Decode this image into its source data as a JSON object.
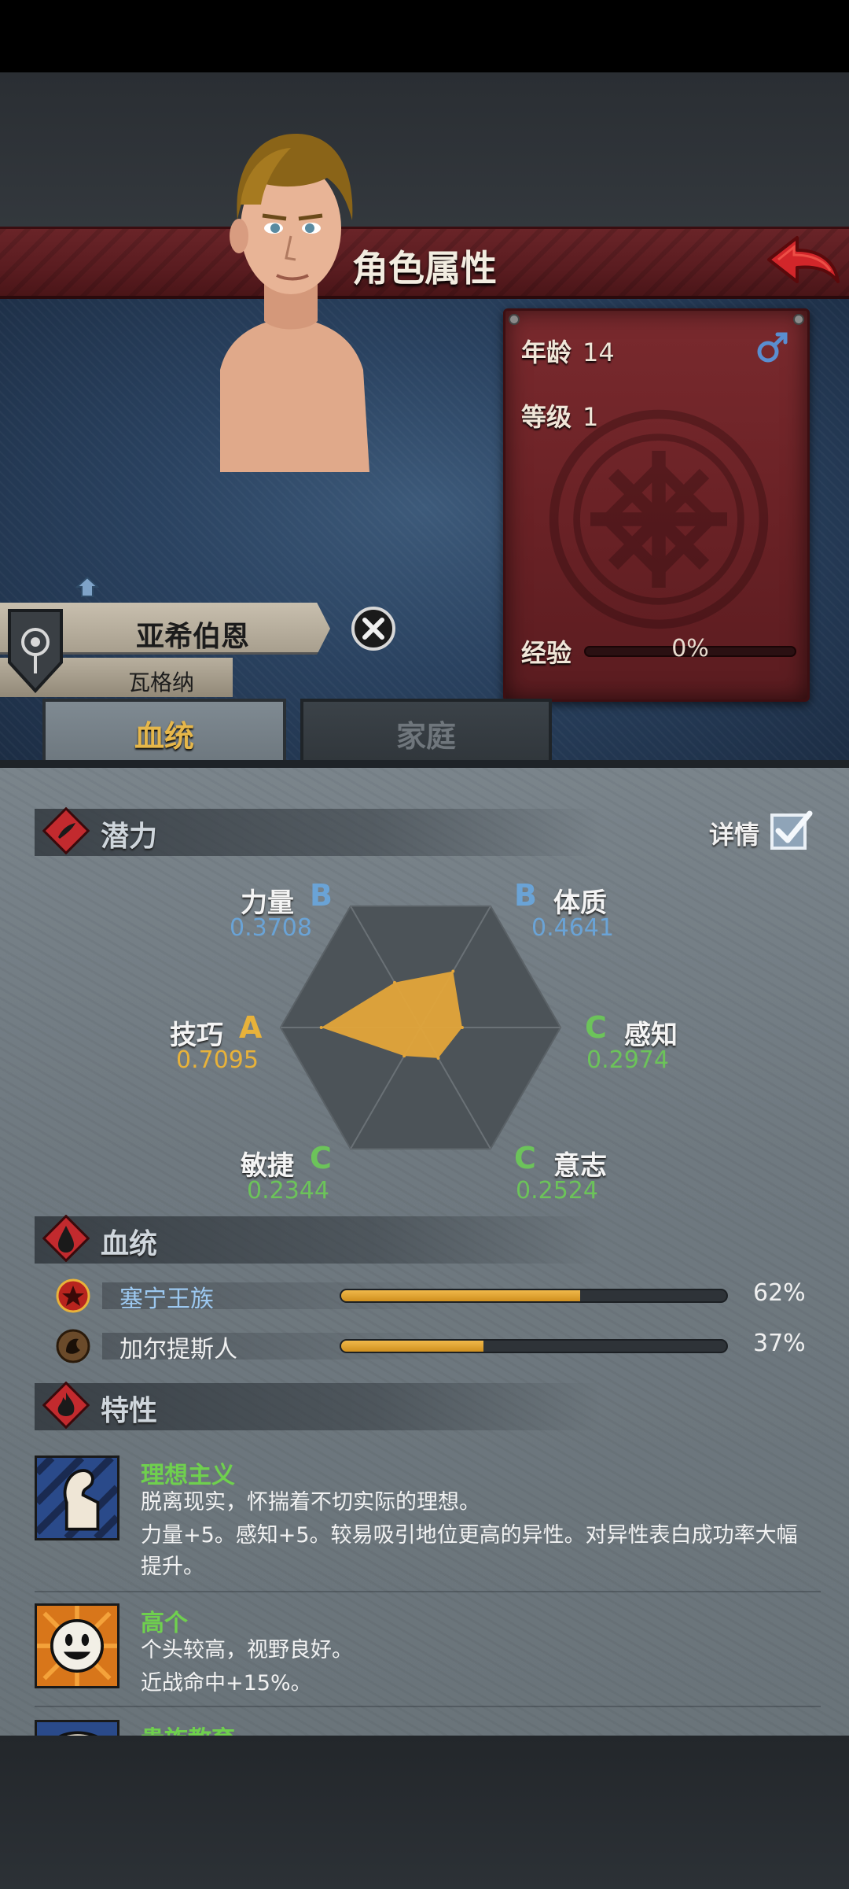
{
  "header": {
    "title": "角色属性"
  },
  "character": {
    "age_label": "年龄",
    "age_value": "14",
    "level_label": "等级",
    "level_value": "1",
    "xp_label": "经验",
    "xp_value": "0%",
    "xp_fraction": 0.0,
    "name": "亚希伯恩",
    "family_name": "瓦格纳",
    "gender": "male"
  },
  "tabs": [
    {
      "label": "血统",
      "active": true
    },
    {
      "label": "家庭",
      "active": false
    }
  ],
  "potential": {
    "title": "潜力",
    "details_label": "详情",
    "details_checked": true,
    "attributes": [
      {
        "name": "力量",
        "grade": "B",
        "value": "0.3708"
      },
      {
        "name": "体质",
        "grade": "B",
        "value": "0.4641"
      },
      {
        "name": "感知",
        "grade": "C",
        "value": "0.2974"
      },
      {
        "name": "意志",
        "grade": "C",
        "value": "0.2524"
      },
      {
        "name": "敏捷",
        "grade": "C",
        "value": "0.2344"
      },
      {
        "name": "技巧",
        "grade": "A",
        "value": "0.7095"
      }
    ]
  },
  "bloodline": {
    "title": "血统",
    "entries": [
      {
        "name": "塞宁王族",
        "percent": "62%",
        "fraction": 0.62,
        "name_color": "#9cc8f0"
      },
      {
        "name": "加尔提斯人",
        "percent": "37%",
        "fraction": 0.37,
        "name_color": "#f0f0f0"
      }
    ]
  },
  "traits": {
    "title": "特性",
    "items": [
      {
        "name": "理想主义",
        "description": "脱离现实，怀揣着不切实际的理想。",
        "effect_line1": "力量+5。感知+5。较易吸引地位更高的异性。对异性表白成功率大幅",
        "effect_line2": "提升。",
        "icon": "flexed-arm-icon"
      },
      {
        "name": "高个",
        "description": "个头较高，视野良好。",
        "effect_line1": "近战命中+15%。",
        "icon": "smiley-face-icon"
      },
      {
        "name": "贵族教育",
        "icon": "scroll-icon"
      }
    ]
  },
  "colors": {
    "accent_gold": "#e8b23a",
    "grade_a": "#e8b23a",
    "grade_b": "#6aa3d6",
    "grade_c": "#6cc35a",
    "trait_name": "#6fd04e",
    "title_bar": "#5a1c20",
    "radar_fill": "#e3a53a"
  }
}
